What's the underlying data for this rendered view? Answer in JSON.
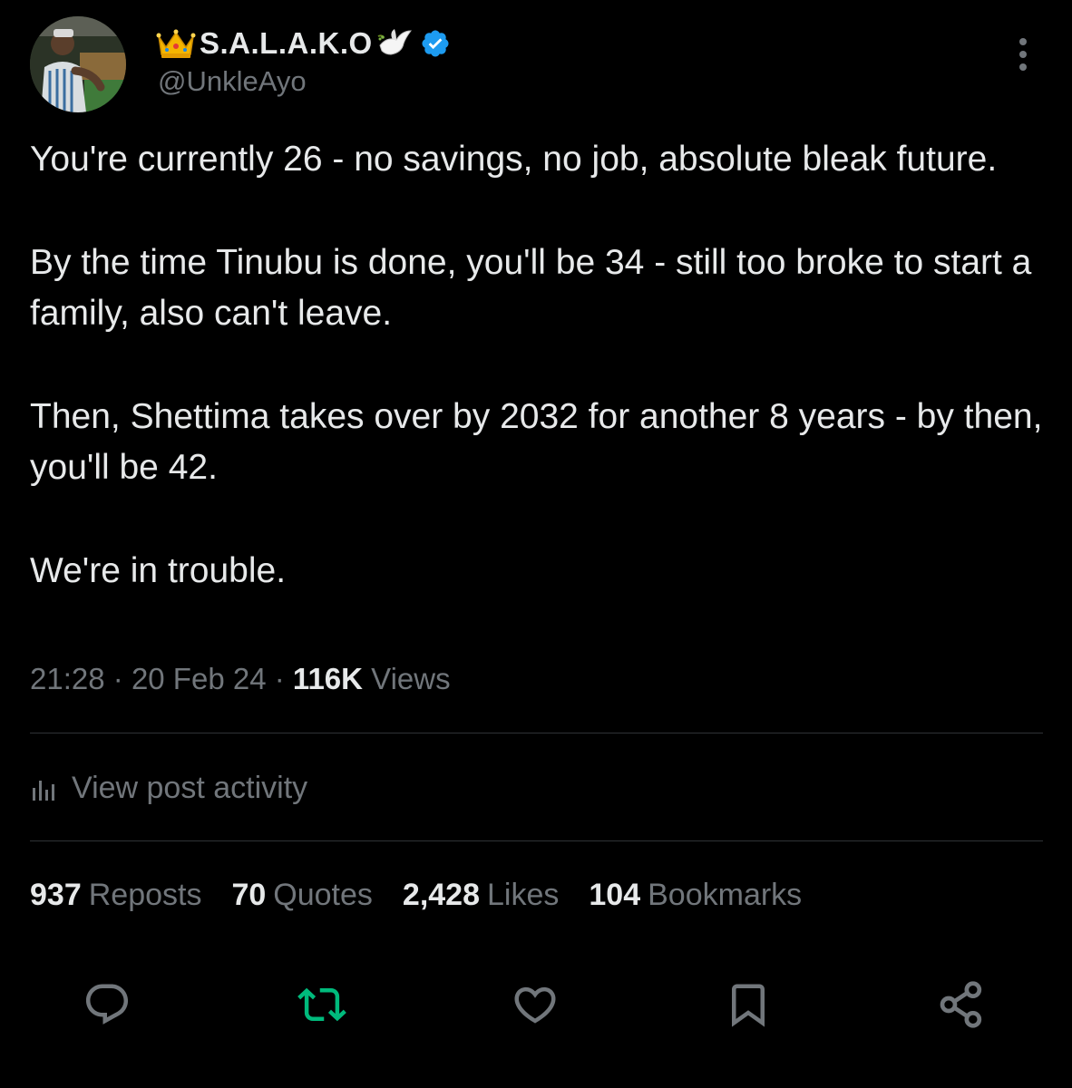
{
  "author": {
    "display_name": "S.A.L.A.K.O",
    "handle": "@UnkleAyo",
    "verified": true,
    "name_icons": [
      "crown-icon",
      "dove-icon"
    ]
  },
  "post": {
    "paragraphs": [
      "You're currently 26 - no savings, no job, absolute bleak future.",
      "By the time Tinubu is done, you'll be 34 - still too broke to start a family, also can't leave.",
      "Then, Shettima takes over by 2032 for another 8 years - by then, you'll be 42.",
      "We're in trouble."
    ],
    "time": "21:28",
    "date": "20 Feb 24",
    "views_count": "116K",
    "views_label": "Views",
    "separator": "·"
  },
  "activity": {
    "label": "View post activity",
    "icon": "bar-chart-icon"
  },
  "stats": [
    {
      "count": "937",
      "label": "Reposts"
    },
    {
      "count": "70",
      "label": "Quotes"
    },
    {
      "count": "2,428",
      "label": "Likes"
    },
    {
      "count": "104",
      "label": "Bookmarks"
    }
  ],
  "actions": [
    {
      "name": "reply",
      "icon": "reply-icon"
    },
    {
      "name": "repost",
      "icon": "repost-icon"
    },
    {
      "name": "like",
      "icon": "heart-icon"
    },
    {
      "name": "bookmark",
      "icon": "bookmark-icon"
    },
    {
      "name": "share",
      "icon": "share-icon"
    }
  ],
  "colors": {
    "background": "#000000",
    "text_primary": "#e7e9ea",
    "text_secondary": "#71767b",
    "verified_blue": "#1d9bf0",
    "repost_green": "#00ba7c",
    "divider": "#2f3336"
  }
}
